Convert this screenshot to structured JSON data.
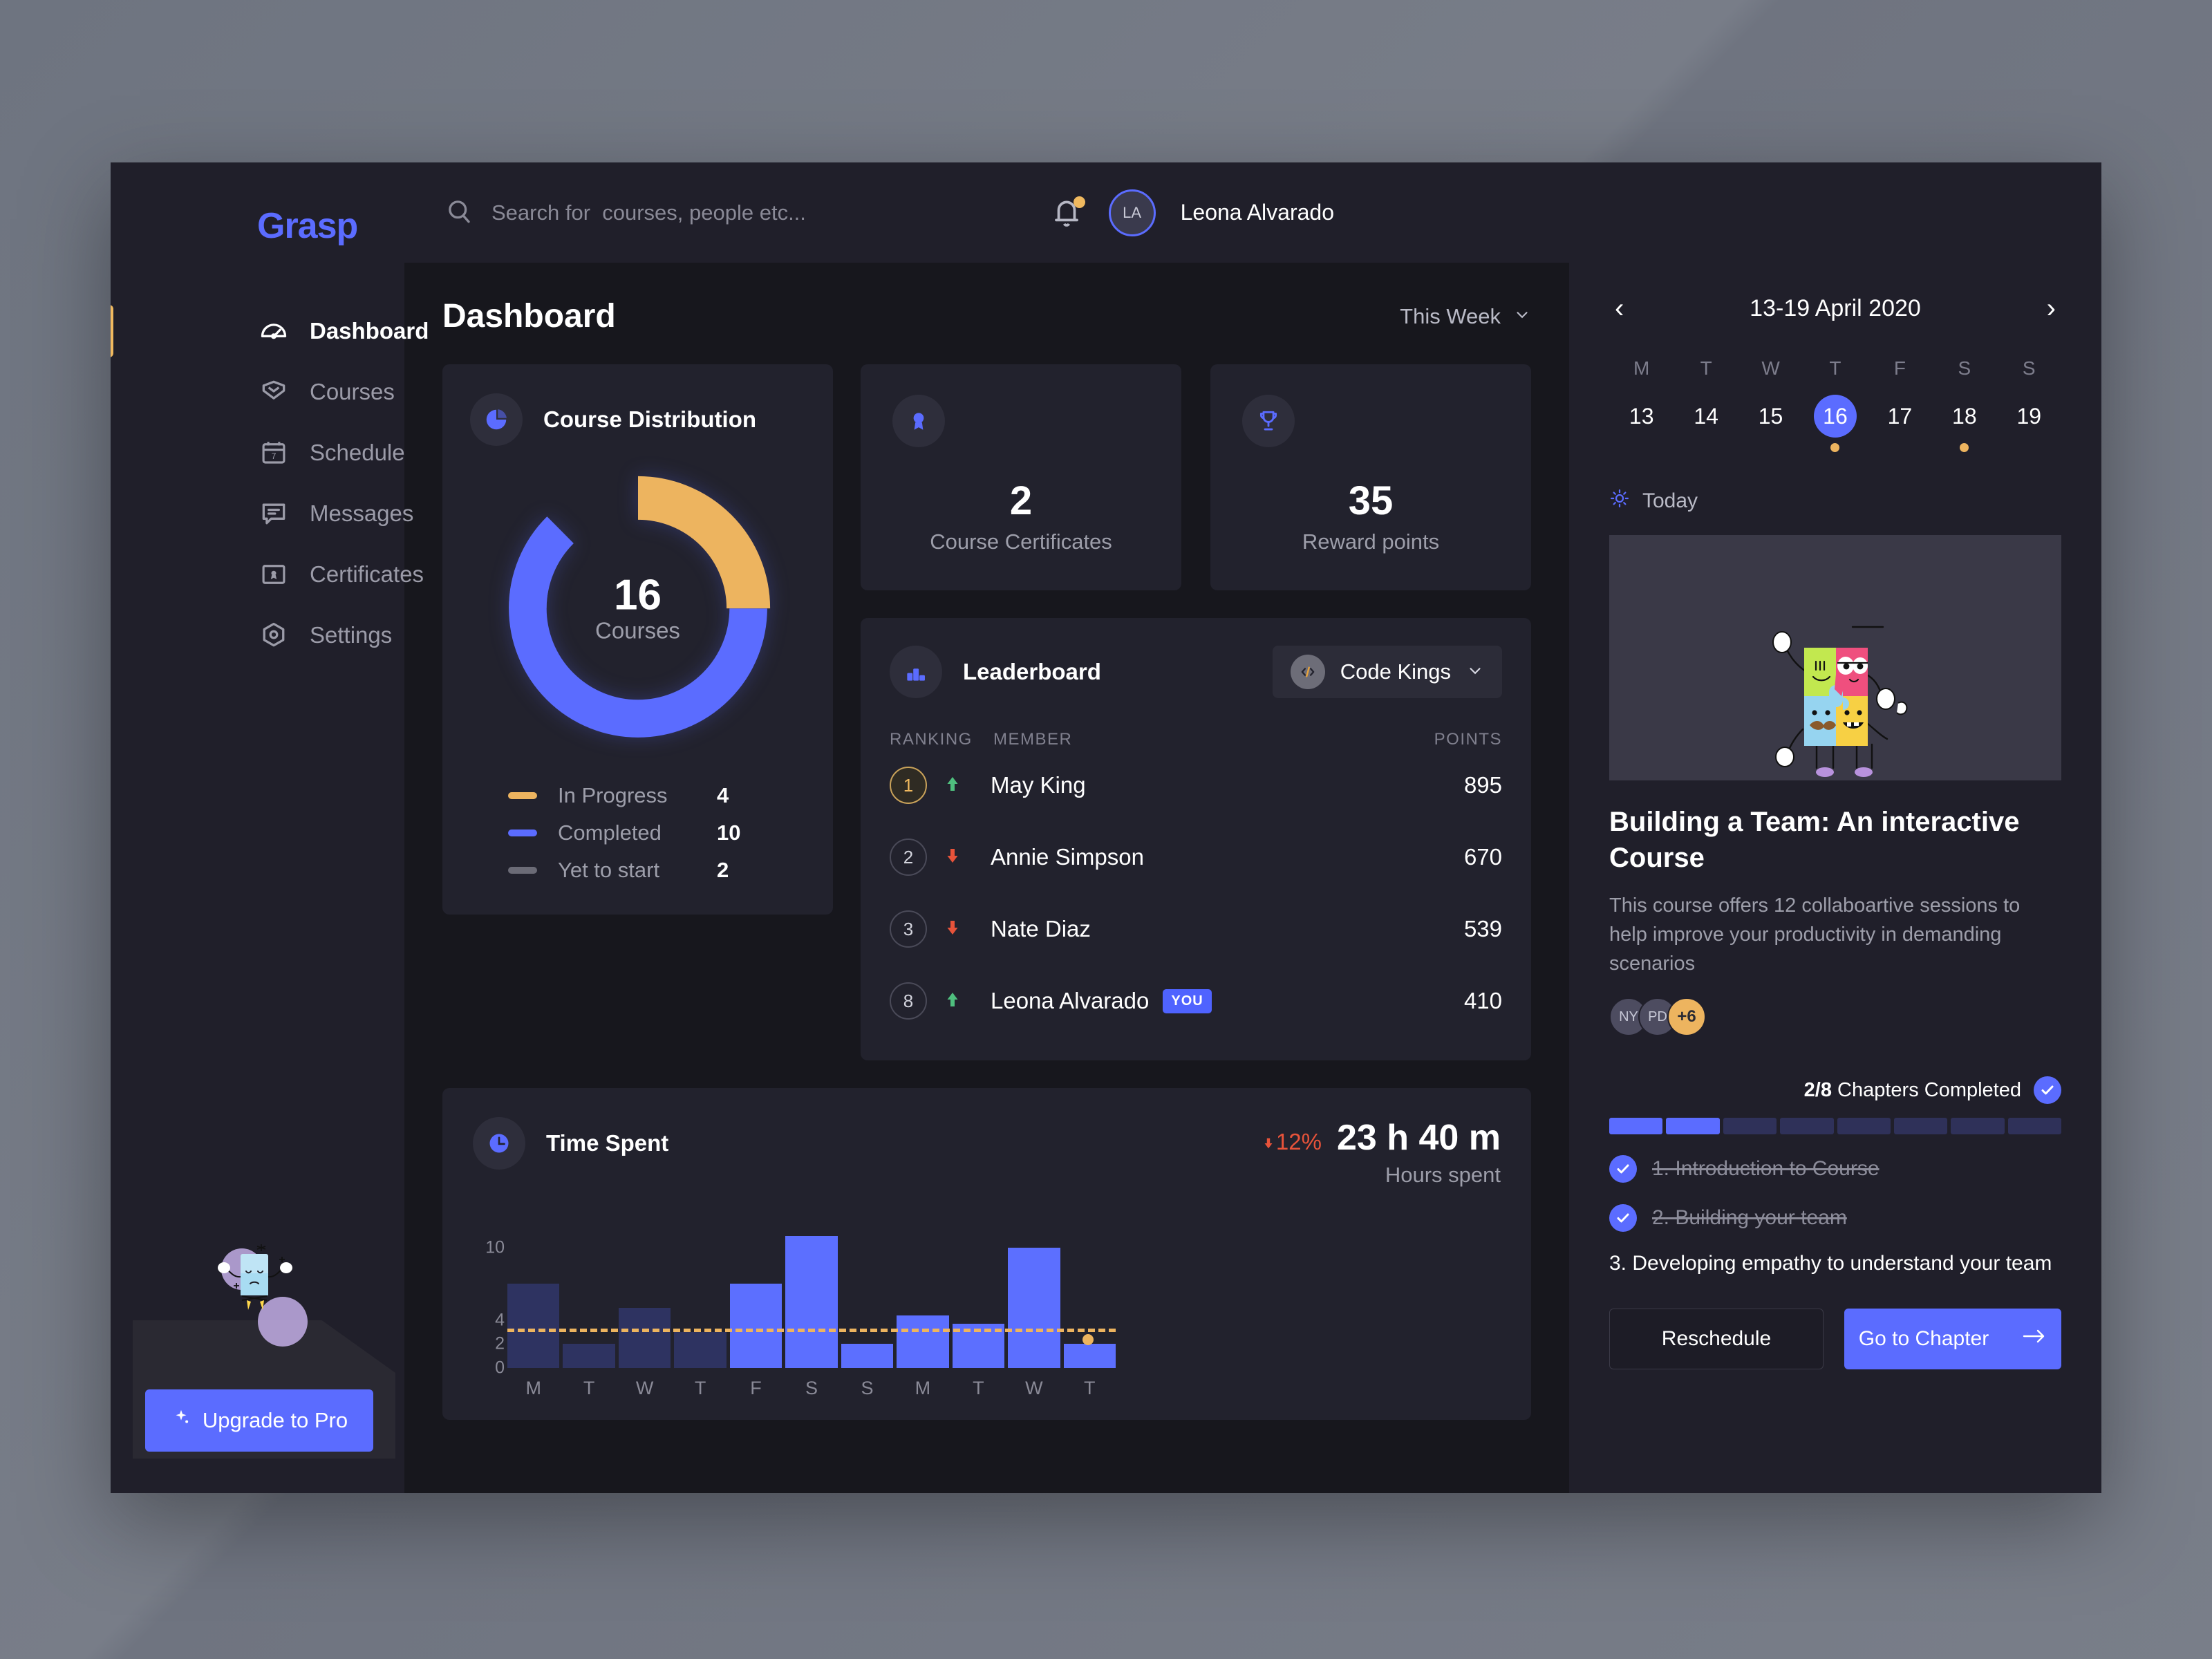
{
  "brand": "Grasp",
  "sidebar": {
    "items": [
      {
        "label": "Dashboard",
        "icon": "dashboard-icon"
      },
      {
        "label": "Courses",
        "icon": "courses-icon"
      },
      {
        "label": "Schedule",
        "icon": "calendar-icon"
      },
      {
        "label": "Messages",
        "icon": "message-icon"
      },
      {
        "label": "Certificates",
        "icon": "certificate-icon"
      },
      {
        "label": "Settings",
        "icon": "gear-icon"
      }
    ],
    "upgrade_label": "Upgrade to Pro"
  },
  "topbar": {
    "search_placeholder": "Search for  courses, people etc...",
    "search_value": "",
    "user_name": "Leona Alvarado",
    "user_initials": "LA"
  },
  "page": {
    "title": "Dashboard",
    "range_filter": "This Week"
  },
  "course_distribution": {
    "title": "Course Distribution",
    "center_value": "16",
    "center_label": "Courses",
    "legend": [
      {
        "name": "In Progress",
        "value": "4",
        "color": "#edb45f"
      },
      {
        "name": "Completed",
        "value": "10",
        "color": "#5b6cff"
      },
      {
        "name": "Yet to start",
        "value": "2",
        "color": "#6b6b76"
      }
    ]
  },
  "stats": [
    {
      "value": "2",
      "label": "Course Certificates",
      "icon": "award-icon"
    },
    {
      "value": "35",
      "label": "Reward points",
      "icon": "trophy-icon"
    }
  ],
  "leaderboard": {
    "title": "Leaderboard",
    "team": "Code Kings",
    "columns": [
      "RANKING",
      "MEMBER",
      "POINTS"
    ],
    "rows": [
      {
        "rank": "1",
        "trend": "up",
        "name": "May King",
        "points": "895",
        "tag": "",
        "gold": true
      },
      {
        "rank": "2",
        "trend": "down",
        "name": "Annie Simpson",
        "points": "670",
        "tag": "",
        "gold": false
      },
      {
        "rank": "3",
        "trend": "down",
        "name": "Nate Diaz",
        "points": "539",
        "tag": "",
        "gold": false
      },
      {
        "rank": "8",
        "trend": "up",
        "name": "Leona Alvarado",
        "points": "410",
        "tag": "YOU",
        "gold": false
      }
    ]
  },
  "time_spent": {
    "title": "Time Spent",
    "delta": "12%",
    "delta_direction": "down",
    "value": "23 h 40 m",
    "sublabel": "Hours spent"
  },
  "chart_data": {
    "type": "bar",
    "title": "Time Spent",
    "xlabel": "",
    "ylabel": "Hours spent",
    "categories": [
      "M",
      "T",
      "W",
      "T",
      "F",
      "S",
      "S",
      "M",
      "T",
      "W",
      "T"
    ],
    "values": [
      7.0,
      2.0,
      5.0,
      3.0,
      7.0,
      11.0,
      2.0,
      4.4,
      3.7,
      10.0,
      2.0
    ],
    "bar_colors": [
      "#2e3361",
      "#2e3361",
      "#2e3361",
      "#2e3361",
      "#5c6fff",
      "#5c6fff",
      "#5c6fff",
      "#5c6fff",
      "#5c6fff",
      "#5c6fff",
      "#5c6fff"
    ],
    "ytick_labels": [
      "10",
      "4",
      "2",
      "0"
    ],
    "ytick_values": [
      10,
      4,
      2,
      0
    ],
    "ylim": [
      0,
      11.8
    ],
    "grid": false,
    "threshold_line": 3.3,
    "threshold_color": "#edb45f",
    "marker": {
      "x_index": 10,
      "value": 2.8,
      "color": "#edb45f"
    },
    "legend": "none"
  },
  "calendar": {
    "range_label": "13-19 April 2020",
    "prev_icon": "chevron-left-icon",
    "next_icon": "chevron-right-icon",
    "day_names": [
      "M",
      "T",
      "W",
      "T",
      "F",
      "S",
      "S"
    ],
    "days": [
      {
        "n": "13",
        "selected": false,
        "event": false
      },
      {
        "n": "14",
        "selected": false,
        "event": false
      },
      {
        "n": "15",
        "selected": false,
        "event": false
      },
      {
        "n": "16",
        "selected": true,
        "event": true
      },
      {
        "n": "17",
        "selected": false,
        "event": false
      },
      {
        "n": "18",
        "selected": false,
        "event": true
      },
      {
        "n": "19",
        "selected": false,
        "event": false
      }
    ],
    "today_label": "Today"
  },
  "course": {
    "title": "Building a Team: An interactive Course",
    "description": "This course offers 12 collaboartive sessions to help improve your productivity in demanding scenarios",
    "members": [
      {
        "initials": "NY",
        "more": false
      },
      {
        "initials": "PD",
        "more": false
      },
      {
        "initials": "+6",
        "more": true
      }
    ],
    "progress_label_bold": "2/8",
    "progress_label_rest": " Chapters Completed",
    "segments_total": 8,
    "segments_done": 2,
    "chapters": [
      {
        "label": "1. Introduction to Course",
        "done": true
      },
      {
        "label": "2. Building your team",
        "done": true
      },
      {
        "label": "3. Developing empathy to   understand your team",
        "done": false
      }
    ],
    "reschedule_label": "Reschedule",
    "goto_label": "Go to Chapter"
  },
  "colors": {
    "accent": "#5b6cff",
    "amber": "#edb45f",
    "danger": "#e8533a",
    "up": "#4fbf7e",
    "down": "#e8533a",
    "panel": "#22222d",
    "sidebar": "#201f2a",
    "bg": "#17171d"
  }
}
